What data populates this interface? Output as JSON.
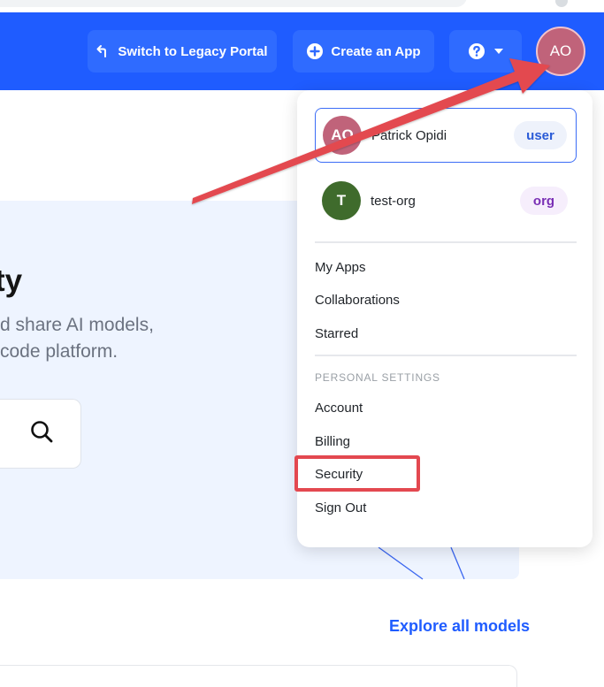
{
  "header": {
    "legacy_label": "Switch to Legacy Portal",
    "create_label": "Create an App",
    "avatar_initials": "AO"
  },
  "hero": {
    "title_fragment": "ty",
    "line1": "d share AI models,",
    "line2": "code platform."
  },
  "explore_label": "Explore all models",
  "dropdown": {
    "accounts": [
      {
        "initials": "AO",
        "name": "Patrick Opidi",
        "badge": "user",
        "color": "#c0637a"
      },
      {
        "initials": "T",
        "name": "test-org",
        "badge": "org",
        "color": "#3f6b2c"
      }
    ],
    "menu": [
      "My Apps",
      "Collaborations",
      "Starred"
    ],
    "section_label": "PERSONAL SETTINGS",
    "settings": [
      "Account",
      "Billing",
      "Security",
      "Sign Out"
    ]
  },
  "colors": {
    "header_bg": "#1f5cff",
    "annotation": "#e34850"
  },
  "icons": {
    "legacy": "return-arrow-icon",
    "create": "plus-circle-icon",
    "help": "question-circle-icon",
    "search": "search-icon"
  }
}
